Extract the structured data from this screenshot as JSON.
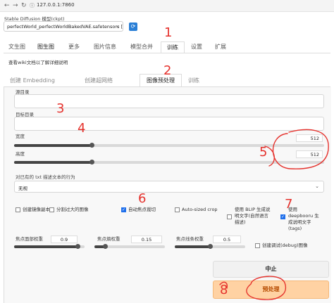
{
  "browser": {
    "url": "127.0.0.1:7860"
  },
  "model": {
    "label": "Stable Diffusion 模型(ckpt)",
    "value": "perfectWorld_perfectWorldBakedVAE.safetensors [",
    "refresh_icon": "refresh-icon"
  },
  "main_tabs": [
    "文生图",
    "图生图",
    "更多",
    "图片信息",
    "模型合并",
    "训练",
    "设置",
    "扩展"
  ],
  "main_tab_active": "训练",
  "wiki_text": "查看wiki文档以了解详细说明",
  "sub_tabs": [
    "创建 Embedding",
    "创建超网络(Hypernetwork)",
    "图像预处理",
    "训练"
  ],
  "sub_tab_active": "图像预处理",
  "form": {
    "source_dir_label": "源目录",
    "target_dir_label": "目标目录",
    "width_label": "宽度",
    "width_value": "512",
    "width_fraction": 0.25,
    "height_label": "高度",
    "height_value": "512",
    "height_fraction": 0.25,
    "caption_label": "对已有的 txt 描述文本的行为",
    "caption_value": "无视",
    "checkboxes": [
      {
        "label": "创建镜像副本",
        "checked": false
      },
      {
        "label": "分割过大的图像",
        "checked": false
      },
      {
        "label": "自动焦点裁切",
        "checked": true
      },
      {
        "label": "Auto-sized crop",
        "checked": false
      },
      {
        "label": "使用 BLIP 生成说明文字(自然语言描述)",
        "checked": false
      },
      {
        "label": "使用 deepbooru 生成说明文字(tags)",
        "checked": true
      }
    ],
    "face_weight_label": "焦点面部权重",
    "face_weight_value": "0.9",
    "face_weight_fraction": 0.9,
    "entropy_weight_label": "焦点熵权重",
    "entropy_weight_value": "0.15",
    "entropy_weight_fraction": 0.15,
    "edges_weight_label": "焦点线条权重",
    "edges_weight_value": "0.5",
    "edges_weight_fraction": 0.5,
    "debug_label": "创建调试(debug)图像",
    "debug_checked": false
  },
  "buttons": {
    "stop": "中止",
    "run": "预处理"
  },
  "annotations": {
    "color": "#e5322d",
    "numbers": [
      "1",
      "2",
      "3",
      "4",
      "5",
      "6",
      "7",
      "8"
    ]
  }
}
